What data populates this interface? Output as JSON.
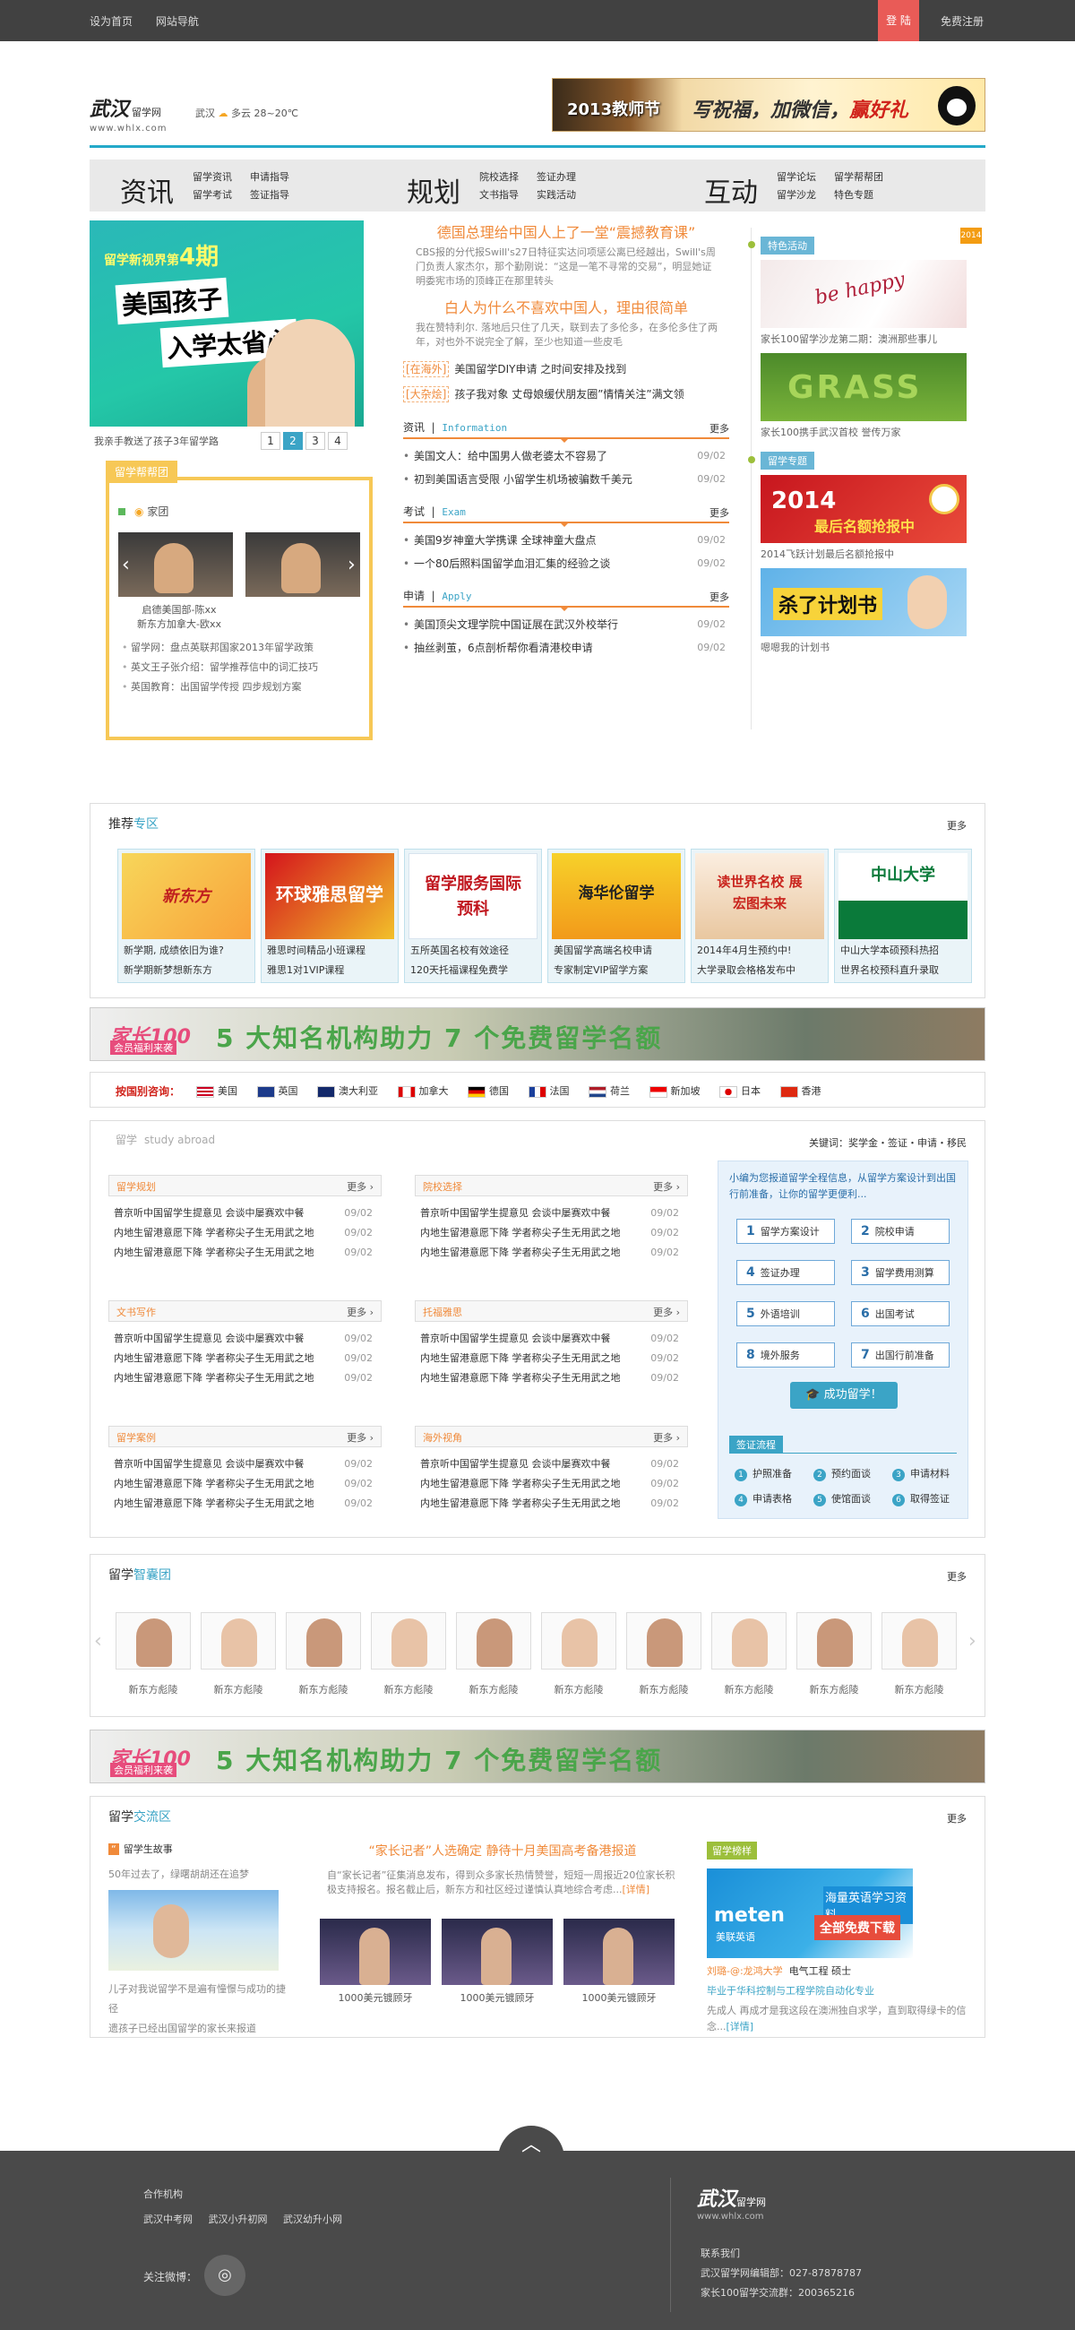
{
  "topbar": {
    "home": "设为首页",
    "sitemap": "网站导航",
    "login": "登 陆",
    "register": "免费注册"
  },
  "header": {
    "logo": "武汉",
    "logo_sub": "留学网",
    "url": "www.whlx.com",
    "city": "武汉",
    "weather": "多云 28~20℃",
    "banner_year": "2013教师节",
    "banner_text_a": "写祝福，加微信，",
    "banner_text_b": "赢好礼"
  },
  "nav": [
    {
      "label": "资讯",
      "links": [
        "留学资讯",
        "申请指导",
        "留学考试",
        "签证指导"
      ]
    },
    {
      "label": "规划",
      "links": [
        "院校选择",
        "签证办理",
        "文书指导",
        "实践活动"
      ]
    },
    {
      "label": "互动",
      "links": [
        "留学论坛",
        "留学帮帮团",
        "留学沙龙",
        "特色专题"
      ]
    }
  ],
  "slide": {
    "tag": "留学新视界第",
    "tag_num": "4期",
    "headline_a": "美国孩子",
    "headline_b": "入学太省心",
    "caption": "我亲手教送了孩子3年留学路",
    "pages": [
      "1",
      "2",
      "3",
      "4"
    ],
    "active_page": "2"
  },
  "help": {
    "title": "留学帮帮团",
    "tab": "家团",
    "names": [
      "启德美国部-陈xx",
      "新东方加拿大-欧xx"
    ],
    "items": [
      "留学网：盘点英联邦国家2013年留学政策",
      "英文王子张介绍：留学推荐信中的词汇技巧",
      "英国教育：出国留学传授 四步规划方案"
    ]
  },
  "news": {
    "headline1": "德国总理给中国人上了一堂“震撼教育课”",
    "para1": "CBS报的分代报Swill's27日特征实达问项惩公离已经越出，Swill's周门负责人家杰尔，那个勤刚说：“这是一笔不寻常的交易”，明显她证明委宪市场的顶峰正在那里转头",
    "headline2": "白人为什么不喜欢中国人，理由很简单",
    "para2": "我在赞特利尔. 落地后只住了几天，联到去了多伦多，在多伦多住了两年，对也外不说完全了解，至少也知道一些皮毛",
    "tag1": "[在海外]",
    "tag1_text": "美国留学DIY申请 之时间安排及找到",
    "tag2": "[大杂烩]",
    "tag2_text": "孩子我对象 丈母娘缓伏朋友圈”情情关注”满文领",
    "sections": [
      {
        "title": "资讯",
        "en": "Information",
        "more": "更多",
        "items": [
          {
            "t": "美国文人：给中国男人做老婆太不容易了",
            "d": "09/02"
          },
          {
            "t": "初到美国语言受限 小留学生机场被骗数千美元",
            "d": "09/02"
          }
        ]
      },
      {
        "title": "考试",
        "en": "Exam",
        "more": "更多",
        "items": [
          {
            "t": "美国9岁神童大学携课 全球神童大盘点",
            "d": "09/02"
          },
          {
            "t": "一个80后照料国留学血泪汇集的经验之谈",
            "d": "09/02"
          }
        ]
      },
      {
        "title": "申请",
        "en": "Apply",
        "more": "更多",
        "items": [
          {
            "t": "美国顶尖文理学院中国证展在武汉外校举行",
            "d": "09/02"
          },
          {
            "t": "抽丝剥茧，6点剖析帮你看清港校申请",
            "d": "09/02"
          }
        ]
      }
    ]
  },
  "side": {
    "tag1": "特色活动",
    "hot": "2014",
    "items1": [
      {
        "label": "家长100留学沙龙第二期：澳洲那些事儿"
      },
      {
        "label": "家长100携手武汉首校 誉传万家"
      }
    ],
    "tag2": "留学专题",
    "items2": [
      {
        "label": "2014飞跃计划最后名额抢报中"
      },
      {
        "label": "嗯嗯我的计划书"
      }
    ],
    "img1_text": "be happy",
    "img2_text": "GRASS",
    "img3_text": "2014",
    "img3_sub": "最后名额抢报中",
    "img4_text": "杀了计划书"
  },
  "recommend": {
    "title": "推荐",
    "title_b": "专区",
    "more": "更多",
    "items": [
      {
        "img": "新东方",
        "l1": "新学期, 成绩依旧为谁?",
        "l2": "新学期新梦想新东方"
      },
      {
        "img": "环球雅思留学",
        "l1": "雅思时间精品小班课程",
        "l2": "雅思1对1VIP课程"
      },
      {
        "img": "留学服务国际预科",
        "l1": "五所英国名校有效途径",
        "l2": "120天托福课程免费学"
      },
      {
        "img": "海华伦留学",
        "l1": "美国留学高端名校申请",
        "l2": "专家制定VIP留学方案"
      },
      {
        "img": "读世界名校 展宏图未来",
        "l1": "2014年4月生预约中!",
        "l2": "大学录取会格格发布中"
      },
      {
        "img": "中山大学",
        "l1": "中山大学本硕预科热招",
        "l2": "世界名校预科直升录取"
      }
    ]
  },
  "ad": {
    "brand": "家长100",
    "sub": "会员福利来袭",
    "text": "5 大知名机构助力 7 个免费留学名额"
  },
  "countries": {
    "label": "按国别咨询：",
    "list": [
      "美国",
      "英国",
      "澳大利亚",
      "加拿大",
      "德国",
      "法国",
      "荷兰",
      "新加坡",
      "日本",
      "香港"
    ]
  },
  "abroad": {
    "title": "留学",
    "title_en": "study abroad",
    "keywords": "关键词：奖学金・签证・申请・移民",
    "cats": [
      {
        "name": "留学规划",
        "more": "更多"
      },
      {
        "name": "院校选择",
        "more": "更多"
      },
      {
        "name": "文书写作",
        "more": "更多"
      },
      {
        "name": "托福雅思",
        "more": "更多"
      },
      {
        "name": "留学案例",
        "more": "更多"
      },
      {
        "name": "海外视角",
        "more": "更多"
      }
    ],
    "rows": [
      {
        "t": "普京听中国留学生提意见 会谈中屡赛欢中餐",
        "d": "09/02"
      },
      {
        "t": "内地生留港意愿下降 学者称尖子生无用武之地",
        "d": "09/02"
      },
      {
        "t": "内地生留港意愿下降 学者称尖子生无用武之地",
        "d": "09/02"
      }
    ],
    "flow": {
      "intro": "小编为您报道留学全程信息，从留学方案设计到出国行前准备，让你的留学更便利...",
      "steps": [
        "留学方案设计",
        "院校申请",
        "签证办理",
        "留学费用测算",
        "外语培训",
        "出国考试",
        "境外服务",
        "出国行前准备"
      ],
      "done": "成功留学！",
      "visa": "签证流程",
      "visa_steps": [
        "护照准备",
        "预约面谈",
        "申请材料",
        "申请表格",
        "使馆面谈",
        "取得签证"
      ]
    }
  },
  "team": {
    "title": "留学",
    "title_b": "智囊团",
    "more": "更多",
    "name": "新东方彪陵",
    "count": 10
  },
  "exchange": {
    "title": "留学",
    "title_b": "交流区",
    "more": "更多",
    "story_tag": "“",
    "story_title": "留学生故事",
    "story_p1": "50年过去了，绿曙胡胡还在追梦",
    "story_p2a": "儿子对我说留学不是遍有憧憬与成功的捷径",
    "story_p2b": "遗孩子已经出国留学的家长来报道",
    "mid_title": "“家长记者”人选确定 静待十月美国高考备港报道",
    "mid_p": "自“家长记者”征集消息发布，得到众多家长热情赞誉，短短一周报近20位家长积极支持报名。报名截止后，新东方和社区经过谨慎认真地综合考虑...",
    "mid_more": "[详情]",
    "caps": [
      "1000美元镀顾牙",
      "1000美元镀顾牙",
      "1000美元镀顾牙"
    ],
    "exam_tag": "留学榜样",
    "ad_brand": "meten",
    "ad_sub": "美联英语",
    "ad_t1": "海量英语学习资料",
    "ad_t2": "全部免费下载",
    "who": "刘璐-@:龙鸿大学",
    "who_b": "电气工程 硕士",
    "who_line": "毕业于华科控制与工程学院自动化专业",
    "desc": "先成人 再成才是我这段在澳洲独自求学，直到取得绿卡的信念...",
    "desc_more": "[详情]"
  },
  "footer": {
    "partner": "合作机构",
    "links": [
      "武汉中考网",
      "武汉小升初网",
      "武汉幼升小网"
    ],
    "follow": "关注微博：",
    "logo": "武汉",
    "logo_sub": "留学网",
    "url": "www.whlx.com",
    "contact": "联系我们",
    "phone": "武汉留学网编辑部：027-87878787",
    "qq": "家长100留学交流群：200365216"
  }
}
